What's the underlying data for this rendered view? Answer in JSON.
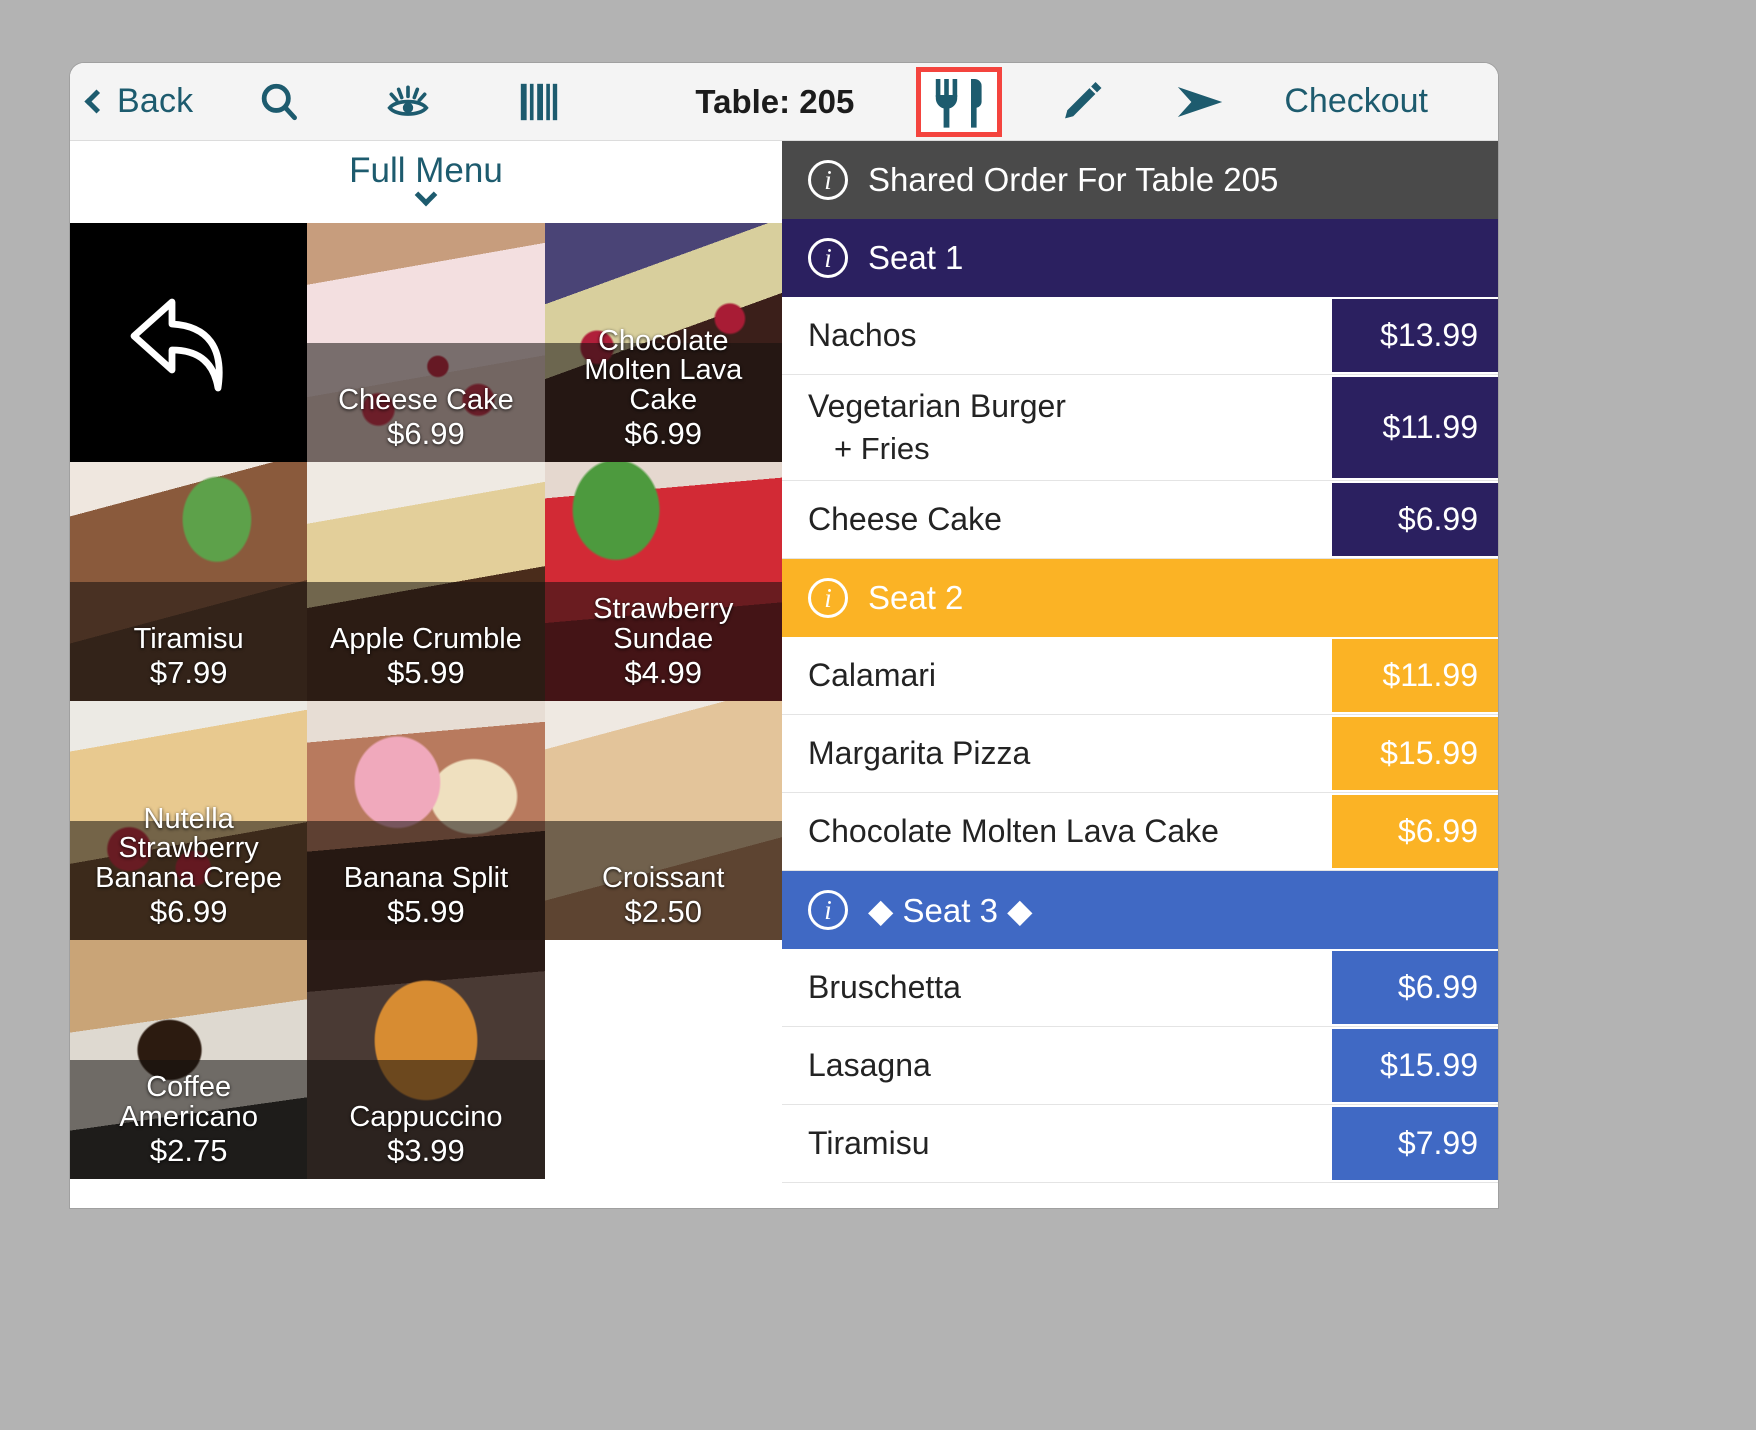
{
  "toolbar": {
    "back_label": "Back",
    "search_icon": "search-icon",
    "eye_icon": "eye-icon",
    "barcode_icon": "barcode-icon",
    "table_label": "Table: 205",
    "dine_in_icon": "fork-knife-icon",
    "edit_icon": "pencil-icon",
    "send_icon": "send-icon",
    "checkout_label": "Checkout",
    "accent_color": "#1d5b6e",
    "highlight_color": "#f4443e"
  },
  "menu": {
    "title": "Full Menu",
    "chevron_icon": "chevron-down-icon",
    "back_tile": {
      "icon": "back-arrow-icon",
      "name": "",
      "price": ""
    },
    "items": [
      {
        "name": "Cheese Cake",
        "price": "$6.99",
        "photo": "p-cheesecake"
      },
      {
        "name": "Chocolate Molten Lava Cake",
        "price": "$6.99",
        "photo": "p-lava"
      },
      {
        "name": "Tiramisu",
        "price": "$7.99",
        "photo": "p-tiramisu"
      },
      {
        "name": "Apple Crumble",
        "price": "$5.99",
        "photo": "p-crumble"
      },
      {
        "name": "Strawberry Sundae",
        "price": "$4.99",
        "photo": "p-sundae"
      },
      {
        "name": "Nutella Strawberry Banana Crepe",
        "price": "$6.99",
        "photo": "p-crepe"
      },
      {
        "name": "Banana Split",
        "price": "$5.99",
        "photo": "p-banana"
      },
      {
        "name": "Croissant",
        "price": "$2.50",
        "photo": "p-croissant"
      },
      {
        "name": "Coffee Americano",
        "price": "$2.75",
        "photo": "p-coffee"
      },
      {
        "name": "Cappuccino",
        "price": "$3.99",
        "photo": "p-cappuccino"
      }
    ]
  },
  "order": {
    "header": {
      "info_icon": "info-icon",
      "title": "Shared Order For Table 205",
      "color": "#4a4a4a"
    },
    "seats": [
      {
        "label": "Seat 1",
        "info_icon": "info-icon",
        "color": "#2b2060",
        "items": [
          {
            "name": "Nachos",
            "modifier": "",
            "price": "$13.99"
          },
          {
            "name": "Vegetarian Burger",
            "modifier": "+ Fries",
            "price": "$11.99"
          },
          {
            "name": "Cheese Cake",
            "modifier": "",
            "price": "$6.99"
          }
        ]
      },
      {
        "label": "Seat 2",
        "info_icon": "info-icon",
        "color": "#fbb325",
        "items": [
          {
            "name": "Calamari",
            "modifier": "",
            "price": "$11.99"
          },
          {
            "name": "Margarita Pizza",
            "modifier": "",
            "price": "$15.99"
          },
          {
            "name": "Chocolate Molten Lava Cake",
            "modifier": "",
            "price": "$6.99"
          }
        ]
      },
      {
        "label": "◆ Seat 3 ◆",
        "info_icon": "info-icon",
        "color": "#4069c4",
        "items": [
          {
            "name": "Bruschetta",
            "modifier": "",
            "price": "$6.99"
          },
          {
            "name": "Lasagna",
            "modifier": "",
            "price": "$15.99"
          },
          {
            "name": "Tiramisu",
            "modifier": "",
            "price": "$7.99"
          }
        ]
      }
    ]
  }
}
